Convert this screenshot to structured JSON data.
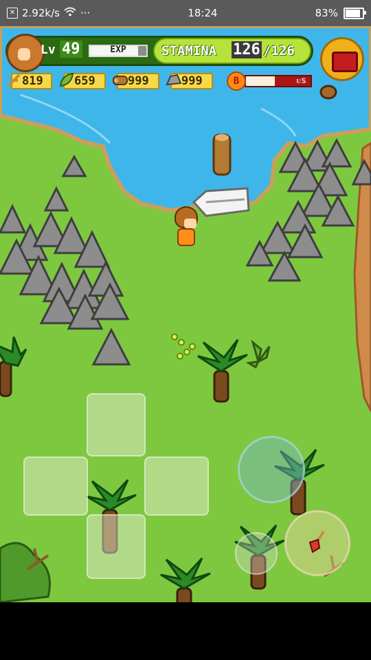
{
  "status_bar": {
    "net_speed": "2.92k/s",
    "dots": "···",
    "time": "18:24",
    "battery": "83%"
  },
  "hud": {
    "lv_label": "Lv",
    "level": "49",
    "exp_label": "EXP",
    "exp_fraction": 0.85,
    "stamina_label": "STAMINA",
    "stamina_current": "126",
    "stamina_max": "/126",
    "bonus_letter": "B",
    "bonus_text": "ᴜs",
    "bonus_fraction": 0.45
  },
  "resources": [
    {
      "icon": "stick-icon",
      "value": "819"
    },
    {
      "icon": "leaf-icon",
      "value": "659"
    },
    {
      "icon": "wood-log-icon",
      "value": "999"
    },
    {
      "icon": "stone-icon",
      "value": "999"
    }
  ],
  "colors": {
    "water": "#3fb6ea",
    "grass": "#7ec840",
    "rock": "#8d8d8d",
    "palm_leaf": "#2a8a26"
  }
}
